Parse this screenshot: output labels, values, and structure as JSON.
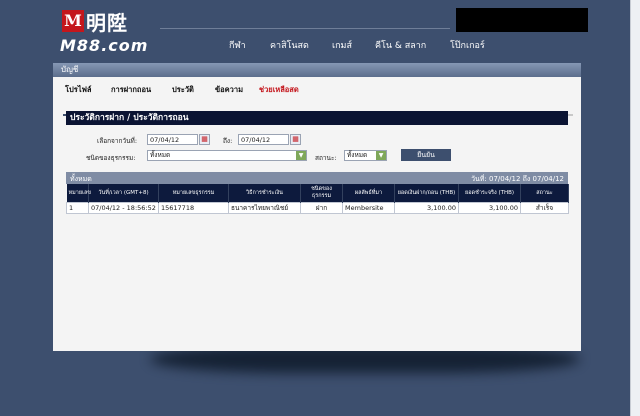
{
  "brand": {
    "logo_mark": "M",
    "name_cn": "明陞",
    "name_en": "M88.com"
  },
  "nav": [
    "กีฬา",
    "คาสิโนสด",
    "เกมส์",
    "คีโน & สลาก",
    "โป๊กเกอร์"
  ],
  "panel": {
    "title": "บัญชี"
  },
  "tabs": [
    {
      "label": "โปรไฟล์",
      "active": false
    },
    {
      "label": "การฝากถอน",
      "active": false
    },
    {
      "label": "ประวัติ",
      "active": false
    },
    {
      "label": "ข้อความ",
      "active": false
    },
    {
      "label": "ช่วยเหลือสด",
      "active": true
    }
  ],
  "section": {
    "title": "ประวัติการฝาก / ประวัติการถอน"
  },
  "filters": {
    "from_label": "เลือกจากวันที่:",
    "from_value": "07/04/12",
    "to_label": "ถึง:",
    "to_value": "07/04/12",
    "type_label": "ชนิดของธุรกรรม:",
    "type_value": "ทั้งหมด",
    "status_label": "สถานะ:",
    "status_value": "ทั้งหมด",
    "submit_label": "ยืนยัน"
  },
  "results": {
    "header_left": "ทั้งหมด",
    "header_right": "วันที่: 07/04/12 ถึง 07/04/12",
    "columns": [
      "หมายเลข",
      "วันที่/เวลา (GMT+8)",
      "หมายเลขธุรกรรม",
      "วิธีการชำระเงิน",
      "ชนิดของธุรกรรม",
      "ผลลัพธ์ที่มา",
      "ยอดเงินฝาก/ถอน (THB)",
      "ยอดชำระจริง (THB)",
      "สถานะ"
    ],
    "rows": [
      [
        "1",
        "07/04/12 - 18:56:52",
        "15617718",
        "ธนาคารไทยพาณิชย์",
        "ฝาก",
        "Membersite",
        "3,100.00",
        "3,100.00",
        "สำเร็จ"
      ]
    ]
  }
}
